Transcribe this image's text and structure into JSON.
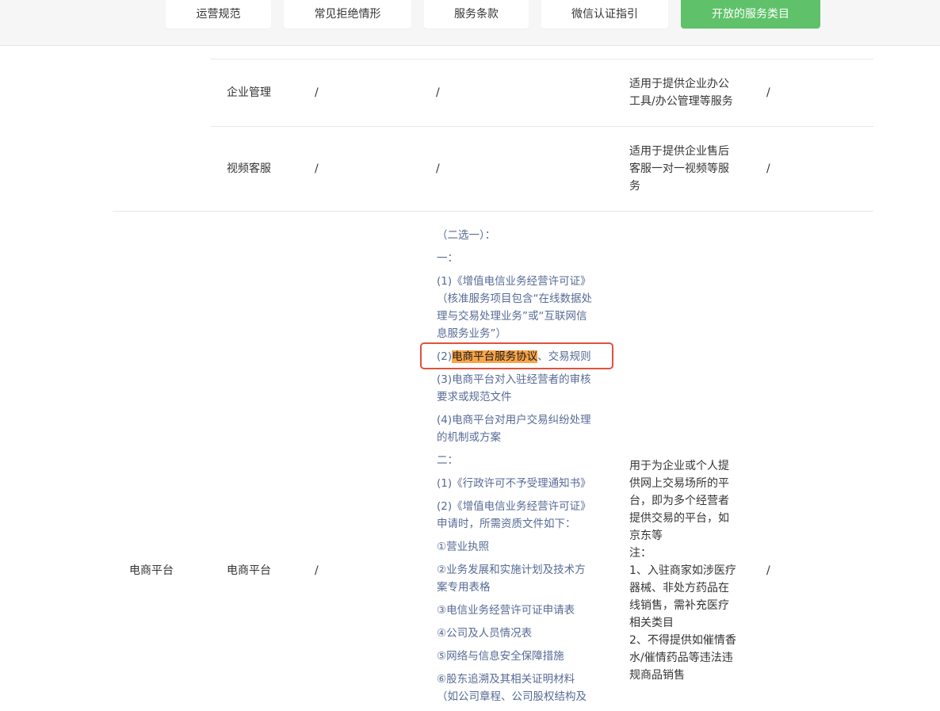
{
  "tabs": [
    {
      "label": "运营规范",
      "active": false
    },
    {
      "label": "常见拒绝情形",
      "active": false
    },
    {
      "label": "服务条款",
      "active": false
    },
    {
      "label": "微信认证指引",
      "active": false
    },
    {
      "label": "开放的服务类目",
      "active": true
    }
  ],
  "colors": {
    "accent": "#5fc26a",
    "link": "#576b95",
    "highlight": "#f8a449",
    "annotation": "#e0523f"
  },
  "table": {
    "rows": [
      {
        "subcategory": "企业管理",
        "col3": "/",
        "col4": "/",
        "desc_lines": [
          "适用于提供企业办公",
          "工具/办公管理等服务"
        ],
        "col6": "/"
      },
      {
        "subcategory": "视频客服",
        "col3": "/",
        "col4": "/",
        "desc_lines": [
          "适用于提供企业售后",
          "客服一对一视频等服",
          "务"
        ],
        "col6": "/"
      },
      {
        "category": "电商平台",
        "subcategory": "电商平台",
        "col3": "/",
        "requirements": {
          "intro": "（二选一）：",
          "opt1_head": "一：",
          "item1": [
            "(1)《增值电信业务经营许可证》",
            "（核准服务项目包含“在线数据处",
            "理与交易处理业务”或“互联网信",
            "息服务业务”）"
          ],
          "item2_prefix": "(2)",
          "item2_highlight": "电商平台服务协议",
          "item2_suffix": "、交易规则",
          "item3": [
            "(3)电商平台对入驻经营者的审核",
            "要求或规范文件"
          ],
          "item4": [
            "(4)电商平台对用户交易纠纷处理",
            "的机制或方案"
          ],
          "opt2_head": "二：",
          "item5": "(1)《行政许可不予受理通知书》",
          "item6": [
            "(2)《增值电信业务经营许可证》",
            "申请时，所需资质文件如下："
          ],
          "sub1": "①营业执照",
          "sub2": [
            "②业务发展和实施计划及技术方",
            "案专用表格"
          ],
          "sub3": "③电信业务经营许可证申请表",
          "sub4": "④公司及人员情况表",
          "sub5": "⑤网络与信息安全保障措施",
          "sub6": [
            "⑥股东追溯及其相关证明材料",
            "（如公司章程、公司股权结构及"
          ]
        },
        "desc_lines": [
          "用于为企业或个人提",
          "供网上交易场所的平",
          "台，即为多个经营者",
          "提供交易的平台，如",
          "京东等",
          "注：",
          "1、入驻商家如涉医疗",
          "器械、非处方药品在",
          "线销售，需补充医疗",
          "相关类目",
          "2、不得提供如催情香",
          "水/催情药品等违法违",
          "规商品销售"
        ],
        "col6": "/"
      }
    ]
  }
}
